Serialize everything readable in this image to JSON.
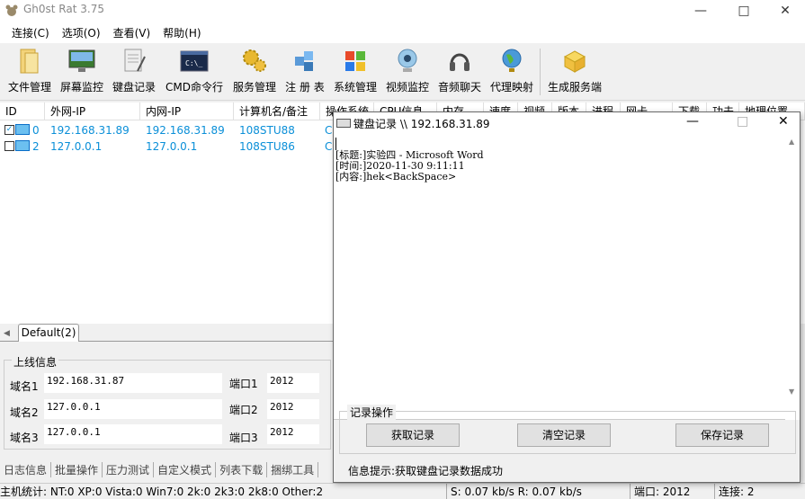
{
  "window": {
    "title": "Gh0st Rat 3.75"
  },
  "menu": [
    "连接(C)",
    "选项(O)",
    "查看(V)",
    "帮助(H)"
  ],
  "toolbar": [
    {
      "label": "文件管理",
      "icon": "folder-icon"
    },
    {
      "label": "屏幕监控",
      "icon": "screen-icon"
    },
    {
      "label": "键盘记录",
      "icon": "keyboard-notepad-icon"
    },
    {
      "label": "CMD命令行",
      "icon": "cmd-icon"
    },
    {
      "label": "服务管理",
      "icon": "gears-icon"
    },
    {
      "label": "注 册 表",
      "icon": "registry-icon"
    },
    {
      "label": "系统管理",
      "icon": "windows-logo-icon"
    },
    {
      "label": "视频监控",
      "icon": "webcam-icon"
    },
    {
      "label": "音频聊天",
      "icon": "headset-icon"
    },
    {
      "label": "代理映射",
      "icon": "globe-icon"
    },
    {
      "label": "生成服务端",
      "icon": "package-icon"
    }
  ],
  "list": {
    "headers": [
      "ID",
      "外网-IP",
      "内网-IP",
      "计算机名/备注",
      "操作系统",
      "CPU信息",
      "内存",
      "速度",
      "视频",
      "版本",
      "进程",
      "网卡",
      "下载",
      "功夫",
      "地理位置"
    ],
    "rows": [
      {
        "id": "0",
        "wan": "192.168.31.89",
        "lan": "192.168.31.89",
        "name": "108STU88",
        "extra": "C",
        "checked": true
      },
      {
        "id": "2",
        "wan": "127.0.0.1",
        "lan": "127.0.0.1",
        "name": "108STU86",
        "extra": "C",
        "checked": false
      }
    ]
  },
  "groupTab": "Default(2)",
  "online": {
    "legend": "上线信息",
    "rows": [
      {
        "domainLabel": "域名1",
        "domain": "192.168.31.87",
        "portLabel": "端口1",
        "port": "2012"
      },
      {
        "domainLabel": "域名2",
        "domain": "127.0.0.1",
        "portLabel": "端口2",
        "port": "2012"
      },
      {
        "domainLabel": "域名3",
        "domain": "127.0.0.1",
        "portLabel": "端口3",
        "port": "2012"
      }
    ]
  },
  "bottomTabs": [
    "日志信息",
    "批量操作",
    "压力测试",
    "自定义模式",
    "列表下载",
    "捆绑工具"
  ],
  "status": {
    "stats": "主机统计:  NT:0  XP:0  Vista:0  Win7:0  2k:0  2k3:0  2k8:0  Other:2",
    "speed": "S: 0.07 kb/s  R: 0.07 kb/s",
    "port": "端口: 2012",
    "conn": "连接: 2"
  },
  "keylog": {
    "title": "键盘记录 \\\\ 192.168.31.89",
    "lines": [
      "[标题:]实验四 - Microsoft Word",
      "[时间:]2020-11-30  9:11:11",
      "[内容:]hek<BackSpace>"
    ],
    "groupLabel": "记录操作",
    "buttons": [
      "获取记录",
      "清空记录",
      "保存记录"
    ],
    "hint": "信息提示:获取键盘记录数据成功"
  }
}
